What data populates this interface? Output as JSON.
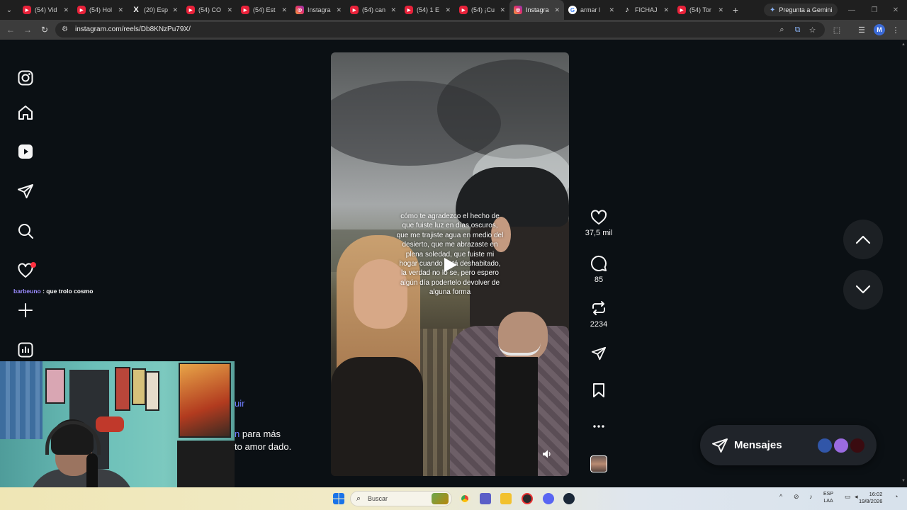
{
  "browser": {
    "tabs": [
      {
        "title": "(54) Vid",
        "icon": "yt"
      },
      {
        "title": "(54) Hol",
        "icon": "yt"
      },
      {
        "title": "(20) Esp",
        "icon": "x"
      },
      {
        "title": "(54) CO",
        "icon": "yt"
      },
      {
        "title": "(54) Est",
        "icon": "yt"
      },
      {
        "title": "Instagra",
        "icon": "ig"
      },
      {
        "title": "(54) can",
        "icon": "yt"
      },
      {
        "title": "(54) 1 E",
        "icon": "yt"
      },
      {
        "title": "(54) ¡Cu",
        "icon": "yt"
      },
      {
        "title": "Instagra",
        "icon": "ig",
        "active": true
      },
      {
        "title": "armar l",
        "icon": "g"
      },
      {
        "title": "FICHAJ",
        "icon": "tt"
      },
      {
        "title": "(54) Tor",
        "icon": "yt"
      }
    ],
    "gemini_label": "Pregunta a Gemini",
    "url": "instagram.com/reels/Db8KNzPu79X/",
    "profile_initial": "M"
  },
  "instagram": {
    "live_comment": {
      "user": "barbeuno",
      "separator": " : ",
      "text": "que trolo cosmo"
    },
    "reel": {
      "caption": "cómo te agradezco el hecho de que fuiste luz en días oscuros, que me trajiste agua en medio del desierto, que me abrazaste en plena soledad, que fuiste mi hogar cuando está deshabitado, la verdad no lo se, pero espero algún día podertelo devolver de alguna forma"
    },
    "actions": {
      "likes": "37,5 mil",
      "comments": "85",
      "reposts": "2234"
    },
    "messages_label": "Mensajes",
    "partial_text": {
      "line0": "uir",
      "line1_accent": "n",
      "line1_rest": " para más",
      "line2": "to amor dado."
    },
    "colors": {
      "background": "#0b1014",
      "accent": "#9b8bff",
      "notification": "#ff3040"
    }
  },
  "taskbar": {
    "search_placeholder": "Buscar",
    "language": "ESP",
    "region": "LAA",
    "time": "16:02",
    "date": "19/8/2026"
  }
}
